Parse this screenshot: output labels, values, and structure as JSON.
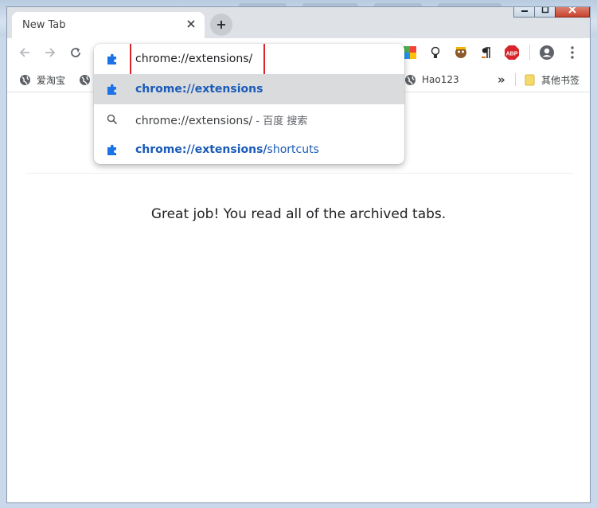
{
  "tab": {
    "title": "New Tab",
    "close_glyph": "✕",
    "new_tab_glyph": "+"
  },
  "omnibox": {
    "value": "chrome://extensions/",
    "suggestions": [
      {
        "icon": "puzzle-icon",
        "bold": "chrome://extensions",
        "rest": ""
      },
      {
        "icon": "search-icon",
        "text": "chrome://extensions/",
        "suffix": " - 百度 搜索"
      },
      {
        "icon": "puzzle-icon",
        "bold": "chrome://extensions/",
        "rest": "shortcuts"
      }
    ]
  },
  "bookmarks": {
    "items": [
      {
        "label": "爱淘宝",
        "icon": "globe-icon"
      },
      {
        "label": "Hao123",
        "icon": "globe-icon"
      }
    ],
    "overflow_glyph": "»",
    "other": {
      "label": "其他书签",
      "icon": "folder-icon"
    }
  },
  "extensions": {
    "abp_label": "ABP"
  },
  "content": {
    "message": "Great job! You read all of the archived tabs."
  },
  "colors": {
    "accent": "#1a5ab8",
    "highlight_box": "#d9262b",
    "selected_row": "#dadbdd"
  }
}
